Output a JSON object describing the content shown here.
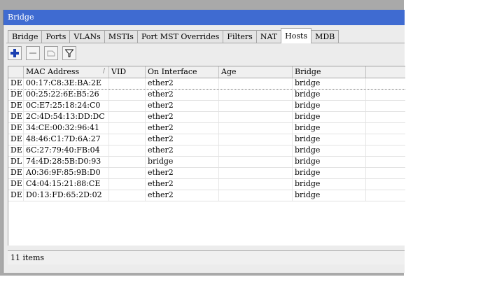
{
  "window": {
    "title": "Bridge"
  },
  "tabs": [
    {
      "label": "Bridge",
      "active": false
    },
    {
      "label": "Ports",
      "active": false
    },
    {
      "label": "VLANs",
      "active": false
    },
    {
      "label": "MSTIs",
      "active": false
    },
    {
      "label": "Port MST Overrides",
      "active": false
    },
    {
      "label": "Filters",
      "active": false
    },
    {
      "label": "NAT",
      "active": false
    },
    {
      "label": "Hosts",
      "active": true
    },
    {
      "label": "MDB",
      "active": false
    }
  ],
  "toolbar": {
    "icons": [
      "add-icon",
      "remove-icon",
      "comment-icon",
      "filter-icon"
    ],
    "accent": "#1a3fb0"
  },
  "table": {
    "columns": [
      "",
      "MAC Address",
      "VID",
      "On Interface",
      "Age",
      "Bridge",
      ""
    ],
    "rows": [
      [
        "DE",
        "00:17:C8:3E:BA:2E",
        "",
        "ether2",
        "",
        "bridge",
        ""
      ],
      [
        "DE",
        "00:25:22:6E:B5:26",
        "",
        "ether2",
        "",
        "bridge",
        ""
      ],
      [
        "DE",
        "0C:E7:25:18:24:C0",
        "",
        "ether2",
        "",
        "bridge",
        ""
      ],
      [
        "DE",
        "2C:4D:54:13:DD:DC",
        "",
        "ether2",
        "",
        "bridge",
        ""
      ],
      [
        "DE",
        "34:CE:00:32:96:41",
        "",
        "ether2",
        "",
        "bridge",
        ""
      ],
      [
        "DE",
        "48:46:C1:7D:6A:27",
        "",
        "ether2",
        "",
        "bridge",
        ""
      ],
      [
        "DE",
        "6C:27:79:40:FB:04",
        "",
        "ether2",
        "",
        "bridge",
        ""
      ],
      [
        "DL",
        "74:4D:28:5B:D0:93",
        "",
        "bridge",
        "",
        "bridge",
        ""
      ],
      [
        "DE",
        "A0:36:9F:85:9B:D0",
        "",
        "ether2",
        "",
        "bridge",
        ""
      ],
      [
        "DE",
        "C4:04:15:21:88:CE",
        "",
        "ether2",
        "",
        "bridge",
        ""
      ],
      [
        "DE",
        "D0:13:FD:65:2D:02",
        "",
        "ether2",
        "",
        "bridge",
        ""
      ]
    ]
  },
  "status": {
    "text": "11 items"
  },
  "colors": {
    "titlebar": "#3f6bd1"
  }
}
